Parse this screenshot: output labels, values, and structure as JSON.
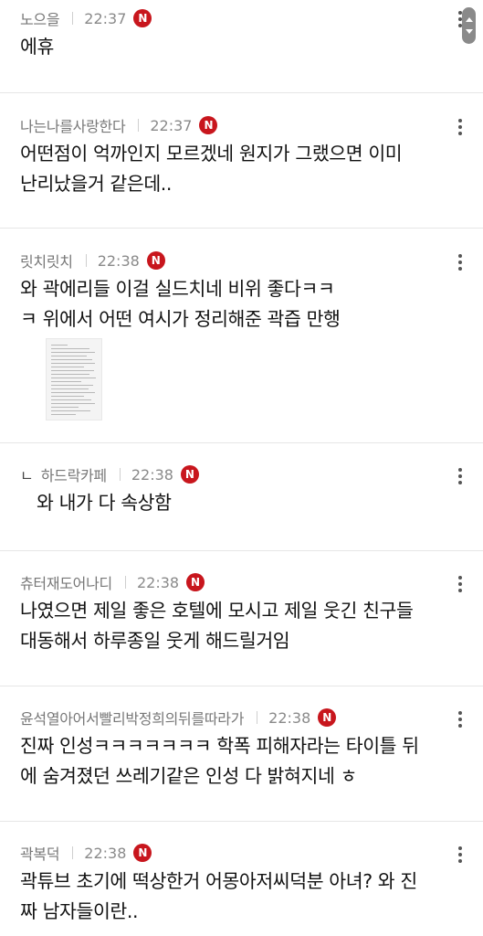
{
  "comments": [
    {
      "author": "노으을",
      "time": "22:37",
      "badge": "N",
      "lines": [
        "에휴"
      ]
    },
    {
      "author": "나는나를사랑한다",
      "time": "22:37",
      "badge": "N",
      "lines": [
        "어떤점이 억까인지 모르겠네 원지가 그랬으면 이미",
        "난리났을거 같은데.."
      ]
    },
    {
      "author": "릿치릿치",
      "time": "22:38",
      "badge": "N",
      "lines": [
        "와 곽에리들 이걸 실드치네 비위 좋다ㅋㅋ",
        "ㅋ 위에서 어떤 여시가 정리해준 곽즙 만행"
      ],
      "has_image": true
    },
    {
      "reply_mark": "ㄴ",
      "author": "하드락카페",
      "time": "22:38",
      "badge": "N",
      "lines": [
        "와 내가 다 속상함"
      ]
    },
    {
      "author": "츄터재도어나디",
      "time": "22:38",
      "badge": "N",
      "lines": [
        "나였으면 제일 좋은 호텔에 모시고 제일 웃긴 친구들",
        "대동해서 하루종일 웃게 해드릴거임"
      ]
    },
    {
      "author": "윤석열아어서빨리박정희의뒤를따라가",
      "time": "22:38",
      "badge": "N",
      "lines": [
        "진짜 인성ㅋㅋㅋㅋㅋㅋㅋ 학폭 피해자라는 타이틀 뒤",
        "에 숨겨졌던 쓰레기같은 인성 다 밝혀지네 ㅎ"
      ]
    },
    {
      "author": "곽복덕",
      "time": "22:38",
      "badge": "N",
      "lines": [
        "곽튜브 초기에 떡상한거 어몽아저씨덕분 아녀? 와 진",
        "짜 남자들이란.."
      ]
    }
  ],
  "icons": {
    "more": "more-vertical-icon",
    "new_badge": "new-badge-icon",
    "scroll": "scrollbar-arrows-icon"
  },
  "colors": {
    "badge": "#c8161d",
    "meta": "#777777",
    "divider": "#e6e6e6"
  }
}
